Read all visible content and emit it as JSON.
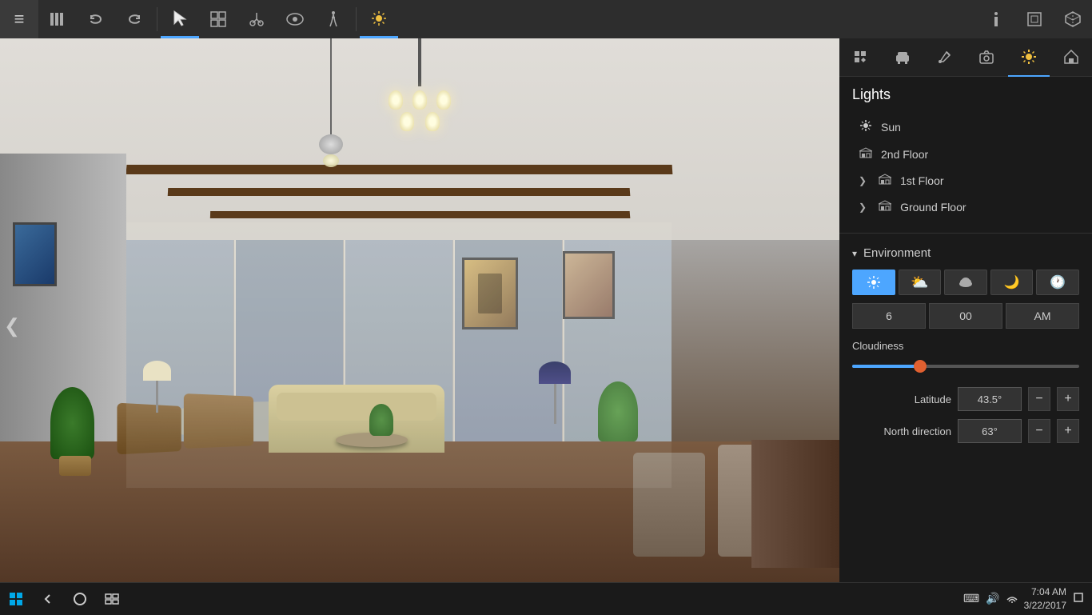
{
  "toolbar": {
    "buttons": [
      {
        "id": "menu",
        "icon": "≡",
        "label": "Menu"
      },
      {
        "id": "library",
        "icon": "📚",
        "label": "Library"
      },
      {
        "id": "undo",
        "icon": "↩",
        "label": "Undo"
      },
      {
        "id": "redo",
        "icon": "↪",
        "label": "Redo"
      },
      {
        "id": "select",
        "icon": "↖",
        "label": "Select",
        "active": true
      },
      {
        "id": "objects",
        "icon": "⊞",
        "label": "Objects"
      },
      {
        "id": "scissors",
        "icon": "✂",
        "label": "Cut"
      },
      {
        "id": "eye",
        "icon": "👁",
        "label": "View"
      },
      {
        "id": "walk",
        "icon": "🚶",
        "label": "Walk"
      },
      {
        "id": "sun",
        "icon": "☀",
        "label": "Sun",
        "active": true
      },
      {
        "id": "info",
        "icon": "ℹ",
        "label": "Info"
      },
      {
        "id": "frame",
        "icon": "⊡",
        "label": "Frame"
      },
      {
        "id": "cube",
        "icon": "⬡",
        "label": "3D"
      }
    ]
  },
  "right_panel": {
    "tabs": [
      {
        "id": "build",
        "icon": "🔧",
        "label": "Build"
      },
      {
        "id": "furniture",
        "icon": "🪑",
        "label": "Furniture"
      },
      {
        "id": "paint",
        "icon": "🖌",
        "label": "Paint"
      },
      {
        "id": "camera",
        "icon": "📷",
        "label": "Camera"
      },
      {
        "id": "lights_tab",
        "icon": "☀",
        "label": "Lights",
        "active": true
      },
      {
        "id": "home",
        "icon": "🏠",
        "label": "Home"
      }
    ],
    "lights": {
      "title": "Lights",
      "items": [
        {
          "id": "sun",
          "icon": "☀",
          "label": "Sun",
          "expandable": false
        },
        {
          "id": "2nd_floor",
          "icon": "🏢",
          "label": "2nd Floor",
          "expandable": false
        },
        {
          "id": "1st_floor",
          "icon": "🏢",
          "label": "1st Floor",
          "expandable": true
        },
        {
          "id": "ground_floor",
          "icon": "🏢",
          "label": "Ground Floor",
          "expandable": true
        }
      ]
    },
    "environment": {
      "title": "Environment",
      "mode_buttons": [
        {
          "id": "clear",
          "icon": "☀",
          "label": "Clear",
          "active": true
        },
        {
          "id": "partly",
          "icon": "⛅",
          "label": "Partly Cloudy"
        },
        {
          "id": "cloudy",
          "icon": "☁",
          "label": "Cloudy"
        },
        {
          "id": "night",
          "icon": "🌙",
          "label": "Night"
        },
        {
          "id": "clock",
          "icon": "🕐",
          "label": "Time"
        }
      ],
      "time": {
        "hour": "6",
        "minute": "00",
        "period": "AM"
      },
      "cloudiness": {
        "label": "Cloudiness",
        "value": 30
      },
      "latitude": {
        "label": "Latitude",
        "value": "43.5°"
      },
      "north_direction": {
        "label": "North direction",
        "value": "63°"
      }
    }
  },
  "nav_arrow": "❮",
  "taskbar": {
    "start_icon": "⊞",
    "back_icon": "←",
    "search_icon": "○",
    "task_icon": "⧉",
    "sys_icons": [
      "🔊",
      "📶",
      "⌨"
    ],
    "time": "7:04 AM",
    "date": "3/22/2017",
    "notification_icon": "🔔"
  }
}
